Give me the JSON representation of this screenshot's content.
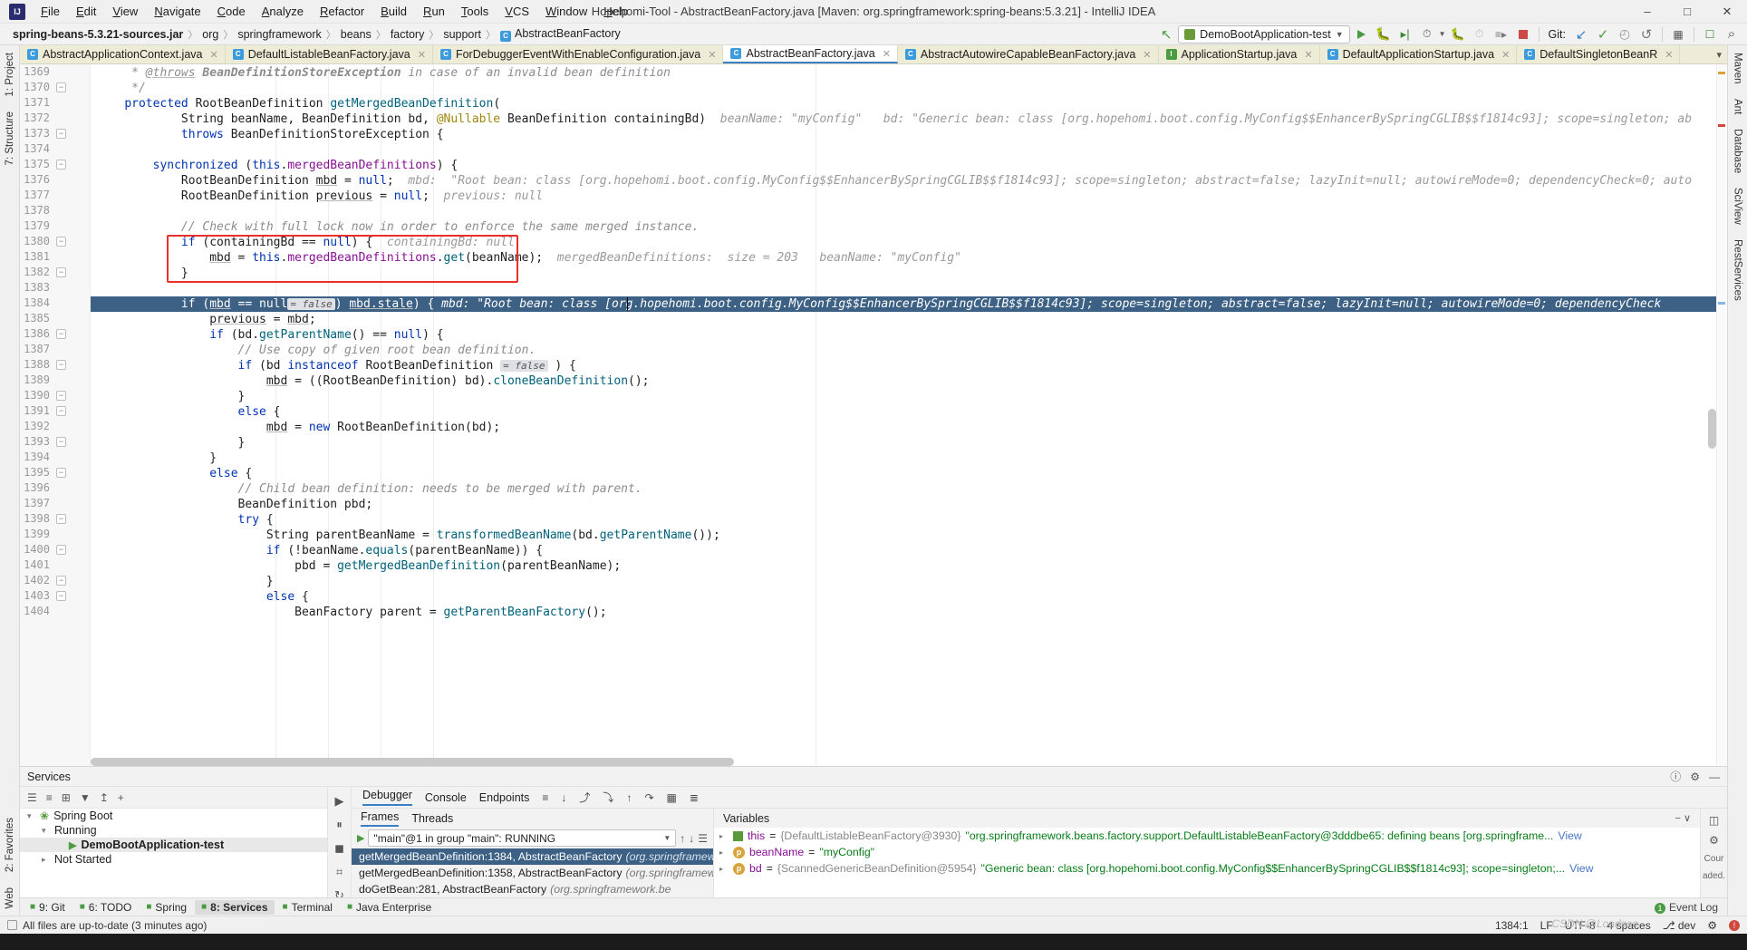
{
  "window": {
    "title": "Hopehomi-Tool - AbstractBeanFactory.java [Maven: org.springframework:spring-beans:5.3.21] - IntelliJ IDEA",
    "minimize": "–",
    "maximize": "□",
    "close": "✕",
    "logo": "IJ"
  },
  "menu": [
    "File",
    "Edit",
    "View",
    "Navigate",
    "Code",
    "Analyze",
    "Refactor",
    "Build",
    "Run",
    "Tools",
    "VCS",
    "Window",
    "Help"
  ],
  "breadcrumbs": [
    {
      "label": "spring-beans-5.3.21-sources.jar",
      "bold": true
    },
    {
      "label": "org",
      "bold": false
    },
    {
      "label": "springframework",
      "bold": false
    },
    {
      "label": "beans",
      "bold": false
    },
    {
      "label": "factory",
      "bold": false
    },
    {
      "label": "support",
      "bold": false
    },
    {
      "label": "AbstractBeanFactory",
      "bold": false,
      "icon": "C"
    }
  ],
  "toolbar": {
    "run_config": "DemoBootApplication-test",
    "git_label": "Git:",
    "back_arrow": "↖",
    "run": "run-icon",
    "debug": "debug-icon",
    "coverage": "coverage-icon",
    "profile": "profile-icon",
    "stop": "stop-icon",
    "update": "↙",
    "commit": "✓",
    "history": "◴",
    "rollback": "↺",
    "settings": "settings-icon",
    "terminal": "terminal-icon",
    "search": "⌕"
  },
  "left_rail": [
    {
      "label": "Project",
      "num": "1:"
    },
    {
      "label": "Structure",
      "num": "7:"
    },
    {
      "label": "Favorites",
      "num": "2:"
    },
    {
      "label": "Web",
      "num": ""
    }
  ],
  "right_rail": [
    {
      "label": "Maven"
    },
    {
      "label": "Ant"
    },
    {
      "label": "Database"
    },
    {
      "label": "SciView"
    },
    {
      "label": "RestServices"
    }
  ],
  "tabs": [
    {
      "label": "AbstractApplicationContext.java",
      "active": false,
      "icon": "C"
    },
    {
      "label": "DefaultListableBeanFactory.java",
      "active": false,
      "icon": "C"
    },
    {
      "label": "ForDebuggerEventWithEnableConfiguration.java",
      "active": false,
      "icon": "C"
    },
    {
      "label": "AbstractBeanFactory.java",
      "active": true,
      "icon": "C"
    },
    {
      "label": "AbstractAutowireCapableBeanFactory.java",
      "active": false,
      "icon": "C"
    },
    {
      "label": "ApplicationStartup.java",
      "active": false,
      "icon": "I"
    },
    {
      "label": "DefaultApplicationStartup.java",
      "active": false,
      "icon": "C"
    },
    {
      "label": "DefaultSingletonBeanR",
      "active": false,
      "icon": "C"
    }
  ],
  "editor": {
    "first_line": 1369,
    "lines": [
      {
        "n": 1369,
        "html": "     <i>* <u>@throws</u> <b>BeanDefinitionStoreException</b> in case of an invalid bean definition</i>"
      },
      {
        "n": 1370,
        "html": "     <i>*/</i>"
      },
      {
        "n": 1371,
        "html": "    <k>protected</k> RootBeanDefinition <m>getMergedBeanDefinition</m>("
      },
      {
        "n": 1372,
        "html": "            String beanName, BeanDefinition bd, <a>@Nullable</a> BeanDefinition containingBd)"
      },
      {
        "n": 1373,
        "html": "            <k>throws</k> BeanDefinitionStoreException {"
      },
      {
        "n": 1374,
        "html": ""
      },
      {
        "n": 1375,
        "html": "        <k>synchronized</k> (<k>this</k>.<f>mergedBeanDefinitions</f>) {"
      },
      {
        "n": 1376,
        "html": "            RootBeanDefinition <u>mbd</u> = <k>null</k>;"
      },
      {
        "n": 1377,
        "html": "            RootBeanDefinition <u>previous</u> = <k>null</k>;"
      },
      {
        "n": 1378,
        "html": ""
      },
      {
        "n": 1379,
        "html": "            <i>// Check with full lock now in order to enforce the same merged instance.</i>"
      },
      {
        "n": 1380,
        "html": "            <k>if</k> (containingBd == <k>null</k>) {"
      },
      {
        "n": 1381,
        "html": "                <u>mbd</u> = <k>this</k>.<f>mergedBeanDefinitions</f>.<m>get</m>(beanName);"
      },
      {
        "n": 1382,
        "html": "            }"
      },
      {
        "n": 1383,
        "html": ""
      },
      {
        "n": 1384,
        "html": "            <k>if</k> (<u>mbd</u> == <k>null</k>"
      },
      {
        "n": 1385,
        "html": "                <u>previous</u> = <u>mbd</u>;"
      },
      {
        "n": 1386,
        "html": "                <k>if</k> (bd.<m>getParentName</m>() == <k>null</k>) {"
      },
      {
        "n": 1387,
        "html": "                    <i>// Use copy of given root bean definition.</i>"
      },
      {
        "n": 1388,
        "html": "                    <k>if</k> (bd <k>instanceof</k> RootBeanDefinition"
      },
      {
        "n": 1389,
        "html": "                        <u>mbd</u> = ((RootBeanDefinition) bd).<m>cloneBeanDefinition</m>();"
      },
      {
        "n": 1390,
        "html": "                    }"
      },
      {
        "n": 1391,
        "html": "                    <k>else</k> {"
      },
      {
        "n": 1392,
        "html": "                        <u>mbd</u> = <k>new</k> RootBeanDefinition(bd);"
      },
      {
        "n": 1393,
        "html": "                    }"
      },
      {
        "n": 1394,
        "html": "                }"
      },
      {
        "n": 1395,
        "html": "                <k>else</k> {"
      },
      {
        "n": 1396,
        "html": "                    <i>// Child bean definition: needs to be merged with parent.</i>"
      },
      {
        "n": 1397,
        "html": "                    BeanDefinition pbd;"
      },
      {
        "n": 1398,
        "html": "                    <k>try</k> {"
      },
      {
        "n": 1399,
        "html": "                        String parentBeanName = <m>transformedBeanName</m>(bd.<m>getParentName</m>());"
      },
      {
        "n": 1400,
        "html": "                        <k>if</k> (!beanName.<m>equals</m>(parentBeanName)) {"
      },
      {
        "n": 1401,
        "html": "                            pbd = <m>getMergedBeanDefinition</m>(parentBeanName);"
      },
      {
        "n": 1402,
        "html": "                        }"
      },
      {
        "n": 1403,
        "html": "                        <k>else</k> {"
      },
      {
        "n": 1404,
        "html": "                            BeanFactory parent = <m>getParentBeanFactory</m>();"
      }
    ],
    "inline_hints": {
      "l1372": "beanName: \"myConfig\"   bd: \"Generic bean: class [org.hopehomi.boot.config.MyConfig$$EnhancerBySpringCGLIB$$f1814c93]; scope=singleton; ab",
      "l1376": "mbd:  \"Root bean: class [org.hopehomi.boot.config.MyConfig$$EnhancerBySpringCGLIB$$f1814c93]; scope=singleton; abstract=false; lazyInit=null; autowireMode=0; dependencyCheck=0; auto",
      "l1377": "previous: null",
      "l1380": "containingBd: null",
      "l1381": "mergedBeanDefinitions:  size = 203   beanName: \"myConfig\"",
      "l1384": "mbd: \"Root bean: class [org.hopehomi.boot.config.MyConfig$$EnhancerBySpringCGLIB$$f1814c93]; scope=singleton; abstract=false; lazyInit=null; autowireMode=0; dependencyCheck",
      "l1384_tail": "|| mbd.stale) {",
      "l1384_false": "= false",
      "l1388_false": "= false",
      "l1388_tail": "}"
    }
  },
  "bottom": {
    "panel_title": "Services",
    "services_toolbar": [
      "☰",
      "≡",
      "⊞",
      "▼",
      "↥",
      "+"
    ],
    "tree": [
      {
        "label": "Spring Boot",
        "level": 0,
        "arrow": "▾",
        "icon": "leaf",
        "sel": false
      },
      {
        "label": "Running",
        "level": 1,
        "arrow": "▾",
        "icon": "none",
        "sel": false
      },
      {
        "label": "DemoBootApplication-test",
        "level": 2,
        "arrow": "",
        "icon": "run",
        "sel": true
      },
      {
        "label": "Not Started",
        "level": 1,
        "arrow": "▸",
        "icon": "none",
        "sel": false
      }
    ],
    "debugger_tabs": [
      {
        "label": "Debugger",
        "active": true
      },
      {
        "label": "Console",
        "active": false,
        "icon": "console-icon"
      },
      {
        "label": "Endpoints",
        "active": false,
        "icon": "endpoints-icon"
      }
    ],
    "step_icons": [
      "≡",
      "↓",
      "⤴",
      "⤵",
      "↑",
      "↷",
      "▦",
      "≣"
    ],
    "left_tools": [
      "▶",
      "⏸",
      "◼",
      "⌗",
      "↻"
    ],
    "frames_tabs": [
      {
        "label": "Frames",
        "active": true
      },
      {
        "label": "Threads",
        "active": false
      }
    ],
    "thread_selector": "\"main\"@1 in group \"main\": RUNNING",
    "frames": [
      {
        "method": "getMergedBeanDefinition:1384, AbstractBeanFactory",
        "pkg": "(org.springframework.be",
        "sel": true
      },
      {
        "method": "getMergedBeanDefinition:1358, AbstractBeanFactory",
        "pkg": "(org.springframework.be",
        "sel": false
      },
      {
        "method": "doGetBean:281, AbstractBeanFactory",
        "pkg": "(org.springframework.be",
        "sel": false
      }
    ],
    "variables_header": "Variables",
    "variables": [
      {
        "tri": "▸",
        "ico": "list",
        "name": "this",
        "eq": " = ",
        "type": "{DefaultListableBeanFactory@3930}",
        "value": " \"org.springframework.beans.factory.support.DefaultListableBeanFactory@3dddbe65: defining beans [org.springframe...",
        "link": "View"
      },
      {
        "tri": "▸",
        "ico": "p",
        "name": "beanName",
        "eq": " = ",
        "type": "",
        "value": "\"myConfig\"",
        "link": ""
      },
      {
        "tri": "▸",
        "ico": "p",
        "name": "bd",
        "eq": " = ",
        "type": "{ScannedGenericBeanDefinition@5954}",
        "value": " \"Generic bean: class [org.hopehomi.boot.config.MyConfig$$EnhancerBySpringCGLIB$$f1814c93]; scope=singleton;...",
        "link": "View"
      }
    ],
    "side_right": [
      "Cour",
      "aded."
    ]
  },
  "toolwindow_bar": {
    "left": [
      {
        "label": "Git",
        "num": "9:",
        "icon": "git-icon"
      },
      {
        "label": "TODO",
        "num": "6:",
        "icon": "todo-icon"
      },
      {
        "label": "Spring",
        "num": "",
        "icon": "spring-icon"
      },
      {
        "label": "Services",
        "num": "8:",
        "icon": "services-icon",
        "active": true
      },
      {
        "label": "Terminal",
        "num": "",
        "icon": "terminal-icon"
      },
      {
        "label": "Java Enterprise",
        "num": "",
        "icon": "java-ee-icon"
      }
    ],
    "right": [
      {
        "label": "Event Log",
        "badge": "1"
      }
    ]
  },
  "status": {
    "message": "All files are up-to-date (3 minutes ago)",
    "caret": "1384:1",
    "line_sep": "LF",
    "encoding": "UTF-8",
    "indent": "4 spaces",
    "branch": "dev",
    "watermark": "CSDN @Loadson"
  },
  "colors": {
    "accent": "#3b7fc4",
    "selection": "#3d6185",
    "red_box": "#e8312a",
    "tab_bg": "#ececd9",
    "keyword": "#0033b3",
    "string": "#067d17",
    "field": "#871094",
    "method": "#00627a",
    "comment": "#8c8c8c",
    "annotation": "#9e880d",
    "green_run": "#4a9b42"
  }
}
